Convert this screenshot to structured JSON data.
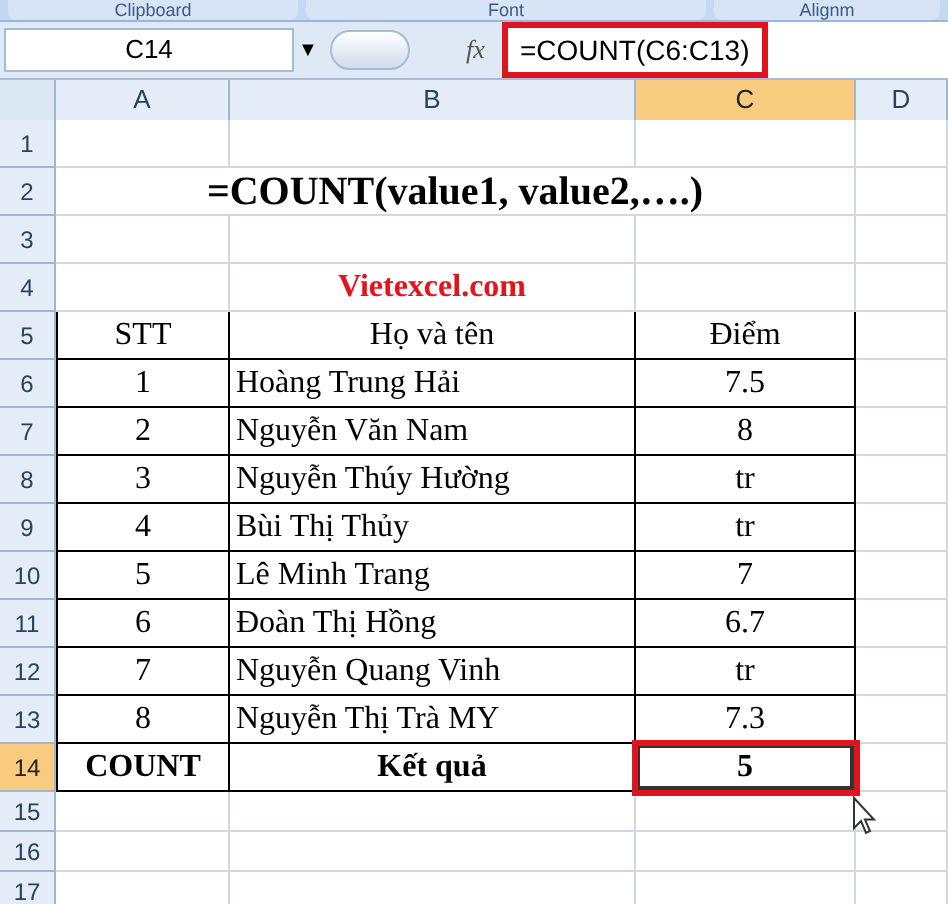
{
  "ribbon_groups": [
    "Clipboard",
    "Font",
    "Alignm"
  ],
  "formula_bar": {
    "name_box": "C14",
    "dropdown": "▼",
    "function_button": "fx",
    "formula": "=COUNT(C6:C13)",
    "highlighted": true
  },
  "columns": [
    {
      "label": "A",
      "selected": false
    },
    {
      "label": "B",
      "selected": false
    },
    {
      "label": "C",
      "selected": true
    },
    {
      "label": "D",
      "selected": false
    }
  ],
  "rows": [
    {
      "number": "1",
      "kind": "blank",
      "selected": false,
      "cells": []
    },
    {
      "number": "2",
      "kind": "title",
      "selected": false,
      "cells": [
        "=COUNT(value1, value2,….)"
      ]
    },
    {
      "number": "3",
      "kind": "blank",
      "selected": false,
      "cells": []
    },
    {
      "number": "4",
      "kind": "caption",
      "selected": false,
      "cells": [
        "Vietexcel.com"
      ]
    },
    {
      "number": "5",
      "kind": "header",
      "selected": false,
      "cells": [
        "STT",
        "Họ và tên",
        "Điểm"
      ]
    },
    {
      "number": "6",
      "kind": "data",
      "selected": false,
      "cells": [
        "1",
        "Hoàng Trung Hải",
        "7.5"
      ]
    },
    {
      "number": "7",
      "kind": "data",
      "selected": false,
      "cells": [
        "2",
        "Nguyễn Văn Nam",
        "8"
      ]
    },
    {
      "number": "8",
      "kind": "data",
      "selected": false,
      "cells": [
        "3",
        "Nguyễn Thúy Hường",
        "tr"
      ]
    },
    {
      "number": "9",
      "kind": "data",
      "selected": false,
      "cells": [
        "4",
        "Bùi Thị Thủy",
        "tr"
      ]
    },
    {
      "number": "10",
      "kind": "data",
      "selected": false,
      "cells": [
        "5",
        "Lê Minh Trang",
        "7"
      ]
    },
    {
      "number": "11",
      "kind": "data",
      "selected": false,
      "cells": [
        "6",
        "Đoàn Thị Hồng",
        "6.7"
      ]
    },
    {
      "number": "12",
      "kind": "data",
      "selected": false,
      "cells": [
        "7",
        "Nguyễn Quang Vinh",
        "tr"
      ]
    },
    {
      "number": "13",
      "kind": "data",
      "selected": false,
      "cells": [
        "8",
        "Nguyễn Thị Trà MY",
        "7.3"
      ]
    },
    {
      "number": "14",
      "kind": "total",
      "selected": true,
      "cells": [
        "COUNT",
        "Kết quả",
        "5"
      ]
    },
    {
      "number": "15",
      "kind": "blank",
      "selected": false,
      "cells": []
    },
    {
      "number": "16",
      "kind": "blank",
      "selected": false,
      "cells": []
    },
    {
      "number": "17",
      "kind": "blank",
      "selected": false,
      "cells": []
    }
  ]
}
